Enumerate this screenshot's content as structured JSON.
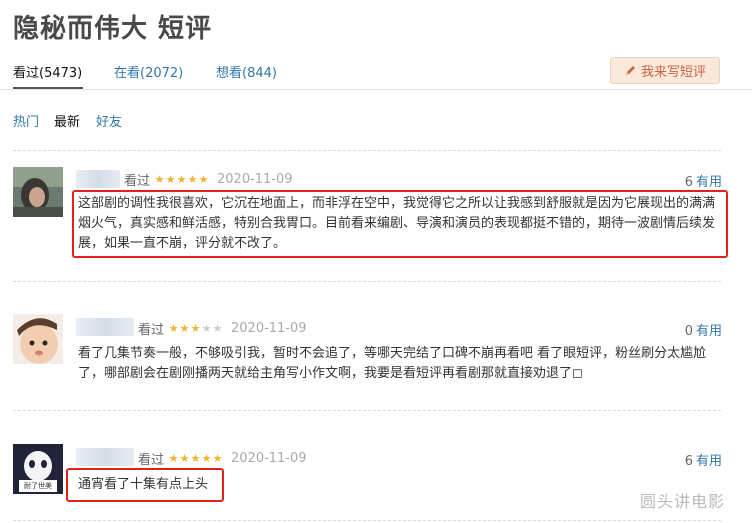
{
  "page": {
    "title": "隐秘而伟大 短评"
  },
  "tabs": [
    {
      "label": "看过(5473)"
    },
    {
      "label": "在看(2072)"
    },
    {
      "label": "想看(844)"
    }
  ],
  "write_button": {
    "label": "我来写短评",
    "icon": "pencil-icon"
  },
  "sort": {
    "hot": "热门",
    "newest": "最新",
    "friends": "好友"
  },
  "comments": [
    {
      "status": "看过",
      "rating": 5,
      "date": "2020-11-09",
      "useful_count": "6",
      "useful_label": "有用",
      "text": "这部剧的调性我很喜欢，它沉在地面上，而非浮在空中，我觉得它之所以让我感到舒服就是因为它展现出的满满烟火气，真实感和鲜活感，特别合我胃口。目前看来编剧、导演和演员的表现都挺不错的，期待一波剧情后续发展，如果一直不崩，评分就不改了。",
      "highlighted": true
    },
    {
      "status": "看过",
      "rating": 3,
      "date": "2020-11-09",
      "useful_count": "0",
      "useful_label": "有用",
      "text": "看了几集节奏一般，不够吸引我，暂时不会追了，等哪天完结了口碑不崩再看吧 看了眼短评，粉丝刷分太尴尬了，哪部剧会在剧刚播两天就给主角写小作文啊，我要是看短评再看剧那就直接劝退了◻",
      "highlighted": false
    },
    {
      "status": "看过",
      "rating": 5,
      "date": "2020-11-09",
      "useful_count": "6",
      "useful_label": "有用",
      "text": "通宵看了十集有点上头",
      "highlighted": true,
      "avatar_caption": "耐了世美"
    }
  ],
  "watermark": "圆头讲电影",
  "colors": {
    "link": "#3377aa",
    "star": "#f4b32d",
    "highlight_box": "#e0211c",
    "button_bg": "#fae9da",
    "button_text": "#ca6445"
  }
}
